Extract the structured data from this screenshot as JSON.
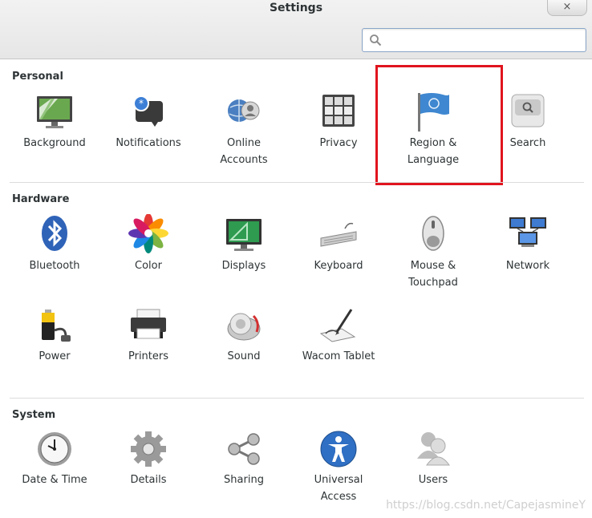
{
  "window": {
    "title": "Settings",
    "close_glyph": "×"
  },
  "search": {
    "placeholder": "",
    "value": ""
  },
  "sections": [
    {
      "title": "Personal",
      "items": [
        {
          "label": "Background",
          "icon": "background-icon"
        },
        {
          "label": "Notifications",
          "icon": "notifications-icon"
        },
        {
          "label": "Online\nAccounts",
          "icon": "online-accounts-icon"
        },
        {
          "label": "Privacy",
          "icon": "privacy-icon"
        },
        {
          "label": "Region &\nLanguage",
          "icon": "flag-icon"
        },
        {
          "label": "Search",
          "icon": "search-app-icon"
        }
      ]
    },
    {
      "title": "Hardware",
      "items": [
        {
          "label": "Bluetooth",
          "icon": "bluetooth-icon"
        },
        {
          "label": "Color",
          "icon": "color-icon"
        },
        {
          "label": "Displays",
          "icon": "displays-icon"
        },
        {
          "label": "Keyboard",
          "icon": "keyboard-icon"
        },
        {
          "label": "Mouse &\nTouchpad",
          "icon": "mouse-icon"
        },
        {
          "label": "Network",
          "icon": "network-icon"
        },
        {
          "label": "Power",
          "icon": "power-icon"
        },
        {
          "label": "Printers",
          "icon": "printer-icon"
        },
        {
          "label": "Sound",
          "icon": "sound-icon"
        },
        {
          "label": "Wacom Tablet",
          "icon": "wacom-tablet-icon"
        }
      ]
    },
    {
      "title": "System",
      "items": [
        {
          "label": "Date & Time",
          "icon": "clock-icon"
        },
        {
          "label": "Details",
          "icon": "gear-icon"
        },
        {
          "label": "Sharing",
          "icon": "share-icon"
        },
        {
          "label": "Universal\nAccess",
          "icon": "accessibility-icon"
        },
        {
          "label": "Users",
          "icon": "users-icon"
        }
      ]
    }
  ],
  "highlight_color": "#e0141e",
  "watermark": "https://blog.csdn.net/CapejasmineY"
}
